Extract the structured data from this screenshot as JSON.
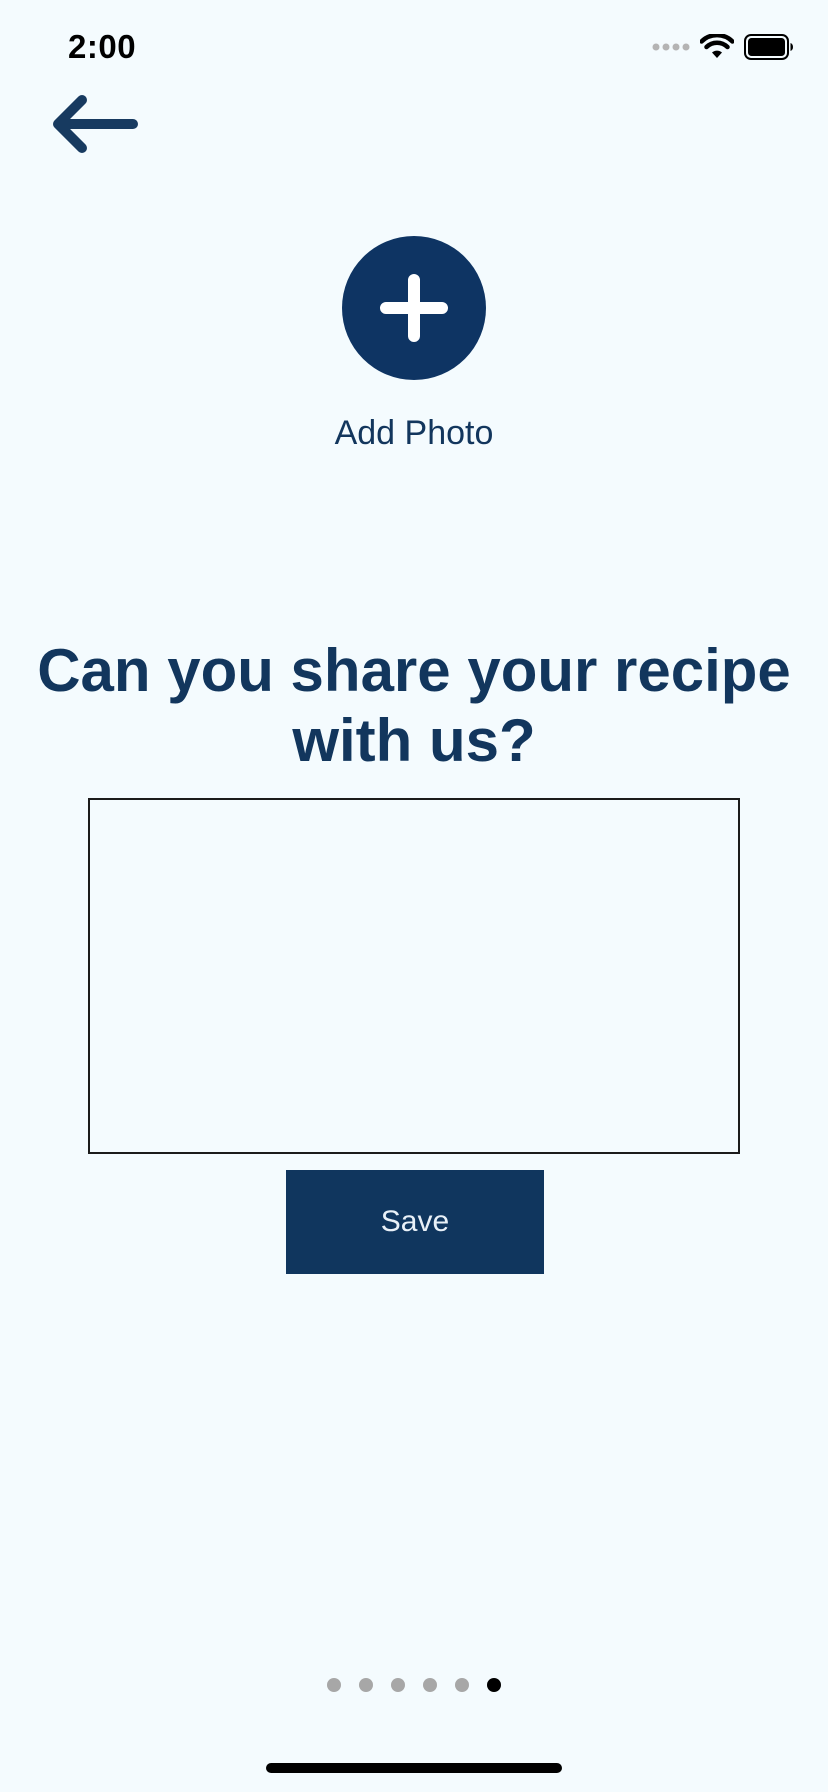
{
  "status_bar": {
    "time": "2:00"
  },
  "icons": {
    "back": "arrow-left-icon",
    "add_photo": "plus-icon",
    "signal": "cellular-signal-icon",
    "wifi": "wifi-icon",
    "battery": "battery-icon"
  },
  "add_photo": {
    "label": "Add Photo"
  },
  "question": {
    "text": "Can you share your recipe with us?"
  },
  "recipe_input": {
    "value": "",
    "placeholder": ""
  },
  "save_button": {
    "label": "Save"
  },
  "pagination": {
    "total": 6,
    "active_index": 5
  },
  "colors": {
    "background": "#f4fbfe",
    "primary": "#10365e",
    "dot_inactive": "#a7a7a7",
    "dot_active": "#000000"
  }
}
